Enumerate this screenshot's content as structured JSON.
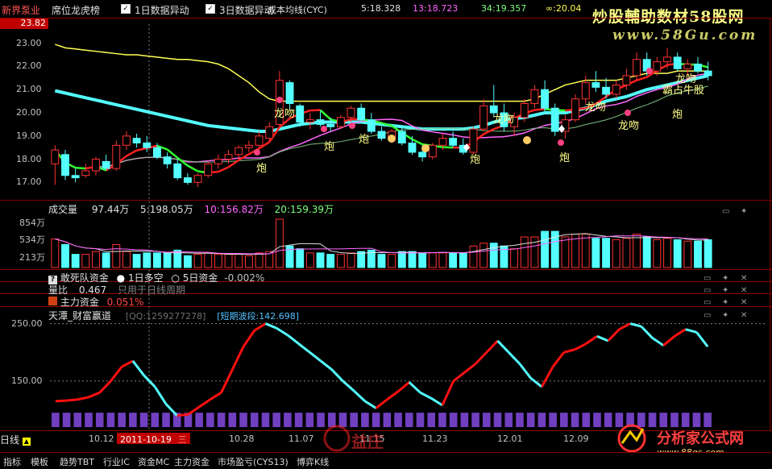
{
  "header": {
    "stock_name": "新界泵业",
    "indicator_name": "席位龙虎榜",
    "check1_label": "1日数据异动",
    "check2_label": "3日数据异动",
    "cyc_label": "成本均线(CYC)",
    "cyc5": "5:18.328",
    "cyc13": "13:18.723",
    "cyc34": "34:19.357",
    "cycinf": "∞:20.04"
  },
  "price_panel": {
    "top_value": "23.82",
    "yticks": [
      "23.00",
      "22.00",
      "21.00",
      "20.00",
      "19.00",
      "18.00",
      "17.00"
    ]
  },
  "volume_panel": {
    "title": "成交量",
    "vol": "97.44万",
    "ma5": "5:198.05万",
    "ma10": "10:156.82万",
    "ma20": "20:159.39万",
    "yticks": [
      "854万",
      "534万",
      "213万"
    ]
  },
  "sub_panels": {
    "p1_title": "敢死队资金",
    "p1_opt1": "1日多空",
    "p1_opt2": "5日资金",
    "p1_val": "-0.002%",
    "p2_title": "量比",
    "p2_val": "0.467",
    "p2_note": "只用于日线周期",
    "p3_title": "主力资金",
    "p3_val": "0.051%"
  },
  "wealth_panel": {
    "title": "天潭_财富赢道",
    "qq": "[QQ:1259277278]",
    "wave": "[短期波段:142.698]",
    "yticks": [
      "250.00",
      "150.00"
    ]
  },
  "x_axis": {
    "ticks": [
      "10.12",
      "10.28",
      "11.07",
      "11.15",
      "11.23",
      "12.01",
      "12.09"
    ],
    "cursor_date": "2011-10-19",
    "cursor_day": "三"
  },
  "toolbar": {
    "period": "日线",
    "items": [
      "指标",
      "模板",
      "趋势TBT",
      "行业IC",
      "资金MC",
      "主力资金",
      "市场盈亏(CYS13)",
      "博弈K线"
    ]
  },
  "watermark": {
    "top_text": "炒股輔助数材58股网",
    "top_url": "www.58Gu.com",
    "bottom_text": "分析家公式网",
    "bottom_url": "www.88gs.com",
    "stamp": "益庄"
  },
  "signals": {
    "pao": "炮",
    "longwen": "龙吻",
    "bazhan": "霸占牛股"
  },
  "colors": {
    "up": "#ff3232",
    "down": "#54ffff",
    "header_red": "#ff3232",
    "yellow": "#ffff54"
  },
  "chart_data": {
    "type": "line",
    "price_ylim": [
      16.7,
      23.82
    ],
    "volume_ylim_wan": [
      0,
      960
    ],
    "wealth_ylim": [
      70,
      255
    ],
    "candles": [
      [
        17.8,
        18.6,
        16.9,
        18.4
      ],
      [
        18.2,
        18.4,
        17.1,
        17.3
      ],
      [
        17.3,
        17.6,
        17.0,
        17.2
      ],
      [
        17.3,
        17.8,
        17.2,
        17.5
      ],
      [
        17.5,
        18.1,
        17.3,
        18.0
      ],
      [
        17.9,
        18.2,
        17.5,
        17.6
      ],
      [
        17.6,
        18.8,
        17.5,
        18.6
      ],
      [
        18.6,
        19.2,
        18.4,
        19.0
      ],
      [
        18.9,
        19.1,
        18.5,
        18.7
      ],
      [
        18.7,
        19.0,
        18.3,
        18.5
      ],
      [
        18.5,
        18.7,
        18.0,
        18.1
      ],
      [
        18.1,
        18.3,
        17.6,
        17.8
      ],
      [
        17.8,
        18.0,
        17.1,
        17.2
      ],
      [
        17.2,
        17.4,
        16.9,
        17.0
      ],
      [
        17.0,
        17.4,
        16.8,
        17.3
      ],
      [
        17.3,
        17.9,
        17.2,
        17.8
      ],
      [
        17.8,
        18.2,
        17.6,
        18.0
      ],
      [
        18.0,
        18.4,
        17.8,
        18.2
      ],
      [
        18.2,
        18.6,
        18.0,
        18.5
      ],
      [
        18.5,
        18.8,
        18.3,
        18.6
      ],
      [
        18.6,
        19.2,
        18.5,
        19.0
      ],
      [
        18.9,
        19.6,
        18.8,
        19.4
      ],
      [
        19.5,
        21.8,
        19.4,
        21.4
      ],
      [
        21.3,
        21.4,
        20.2,
        20.4
      ],
      [
        20.3,
        20.4,
        19.4,
        19.6
      ],
      [
        19.6,
        20.0,
        19.3,
        19.7
      ],
      [
        19.7,
        20.1,
        19.4,
        19.5
      ],
      [
        19.5,
        19.8,
        19.2,
        19.4
      ],
      [
        19.4,
        19.9,
        19.3,
        19.8
      ],
      [
        19.8,
        20.3,
        19.6,
        20.2
      ],
      [
        20.2,
        20.4,
        19.6,
        19.7
      ],
      [
        19.7,
        20.0,
        19.1,
        19.2
      ],
      [
        19.2,
        19.4,
        18.8,
        18.9
      ],
      [
        18.9,
        19.3,
        18.7,
        19.2
      ],
      [
        19.2,
        19.4,
        18.6,
        18.7
      ],
      [
        18.7,
        19.0,
        18.2,
        18.3
      ],
      [
        18.3,
        18.6,
        17.9,
        18.1
      ],
      [
        18.1,
        18.7,
        18.0,
        18.6
      ],
      [
        18.6,
        19.1,
        18.4,
        18.9
      ],
      [
        18.9,
        19.2,
        18.5,
        18.6
      ],
      [
        18.6,
        18.9,
        18.2,
        18.3
      ],
      [
        18.3,
        19.4,
        18.2,
        19.3
      ],
      [
        19.3,
        20.6,
        19.2,
        20.3
      ],
      [
        20.3,
        21.2,
        19.8,
        20.0
      ],
      [
        20.0,
        20.4,
        19.2,
        19.4
      ],
      [
        19.4,
        20.0,
        19.0,
        19.8
      ],
      [
        19.8,
        20.6,
        19.6,
        20.4
      ],
      [
        20.4,
        21.2,
        20.2,
        21.0
      ],
      [
        21.0,
        21.4,
        20.0,
        20.2
      ],
      [
        20.2,
        20.4,
        19.0,
        19.2
      ],
      [
        19.2,
        19.9,
        18.9,
        19.7
      ],
      [
        19.7,
        20.8,
        19.6,
        20.6
      ],
      [
        20.6,
        21.6,
        20.4,
        21.3
      ],
      [
        21.3,
        21.8,
        20.9,
        21.1
      ],
      [
        21.1,
        21.5,
        20.6,
        20.8
      ],
      [
        20.8,
        21.4,
        20.6,
        21.2
      ],
      [
        21.2,
        21.9,
        21.0,
        21.6
      ],
      [
        21.6,
        22.6,
        21.4,
        22.3
      ],
      [
        22.3,
        22.6,
        21.6,
        21.8
      ],
      [
        21.8,
        22.4,
        21.6,
        22.2
      ],
      [
        22.2,
        22.8,
        21.9,
        22.4
      ],
      [
        22.4,
        22.6,
        21.8,
        21.9
      ],
      [
        21.9,
        22.3,
        21.6,
        22.1
      ],
      [
        22.1,
        22.4,
        21.7,
        21.8
      ],
      [
        21.8,
        22.2,
        21.4,
        21.6
      ]
    ],
    "cyc_inf": [
      22.95,
      22.8,
      22.75,
      22.7,
      22.65,
      22.6,
      22.55,
      22.5,
      22.5,
      22.45,
      22.4,
      22.35,
      22.3,
      22.3,
      22.25,
      22.2,
      22.1,
      21.9,
      21.6,
      21.3,
      20.9,
      20.6,
      20.5,
      20.5,
      20.5,
      20.5,
      20.5,
      20.5,
      20.5,
      20.5,
      20.5,
      20.5,
      20.5,
      20.5,
      20.5,
      20.5,
      20.5,
      20.5,
      20.5,
      20.5,
      20.5,
      20.5,
      20.5,
      20.5,
      20.5,
      20.5,
      20.5,
      20.6,
      20.8,
      21.0,
      21.2,
      21.3,
      21.4,
      21.4,
      21.4,
      21.4,
      21.5,
      21.6,
      21.7,
      21.7,
      21.7,
      21.8,
      21.8,
      21.8,
      21.8
    ],
    "cyc34": [
      20.95,
      20.85,
      20.75,
      20.65,
      20.55,
      20.45,
      20.35,
      20.25,
      20.15,
      20.05,
      19.95,
      19.85,
      19.75,
      19.65,
      19.55,
      19.45,
      19.4,
      19.35,
      19.3,
      19.25,
      19.2,
      19.2,
      19.3,
      19.4,
      19.5,
      19.55,
      19.6,
      19.6,
      19.6,
      19.6,
      19.6,
      19.55,
      19.5,
      19.45,
      19.4,
      19.35,
      19.3,
      19.3,
      19.3,
      19.3,
      19.3,
      19.35,
      19.45,
      19.6,
      19.7,
      19.75,
      19.8,
      19.9,
      20.0,
      20.0,
      20.0,
      20.1,
      20.2,
      20.35,
      20.5,
      20.6,
      20.7,
      20.85,
      21.0,
      21.1,
      21.2,
      21.3,
      21.4,
      21.5,
      21.6
    ],
    "wealth": [
      115,
      116,
      118,
      122,
      130,
      150,
      175,
      185,
      160,
      140,
      110,
      90,
      92,
      105,
      118,
      130,
      170,
      210,
      238,
      250,
      242,
      230,
      215,
      200,
      185,
      170,
      150,
      133,
      115,
      103,
      118,
      132,
      148,
      130,
      120,
      108,
      150,
      165,
      180,
      200,
      220,
      200,
      180,
      155,
      140,
      175,
      200,
      205,
      215,
      228,
      220,
      240,
      250,
      245,
      225,
      212,
      228,
      240,
      235,
      210
    ]
  }
}
